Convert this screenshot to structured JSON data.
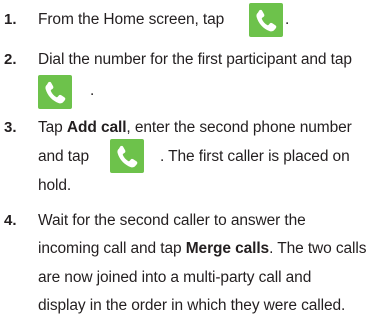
{
  "steps": [
    {
      "number": "1.",
      "text_before": "From the Home screen, tap",
      "text_after": "."
    },
    {
      "number": "2.",
      "text_before": "Dial the number for the first participant and tap",
      "text_after": "."
    },
    {
      "number": "3.",
      "text_tap": "Tap",
      "bold_add_call": "Add call",
      "text_after_add_call": ", enter the second phone number",
      "text_and_tap": "and tap",
      "text_after_icon": ". The first caller is placed on",
      "text_hold": "hold."
    },
    {
      "number": "4.",
      "line1": "Wait for the second caller to answer the",
      "text_incoming": "incoming call and tap",
      "bold_merge_calls": "Merge calls",
      "text_after_merge": ". The two calls",
      "line3": "are now joined into a multi-party call and",
      "line4": "display in the order in which they were called."
    }
  ],
  "icons": {
    "phone_button": "phone-icon",
    "button_color": "#6dc24b",
    "glyph_color": "#ffffff"
  }
}
